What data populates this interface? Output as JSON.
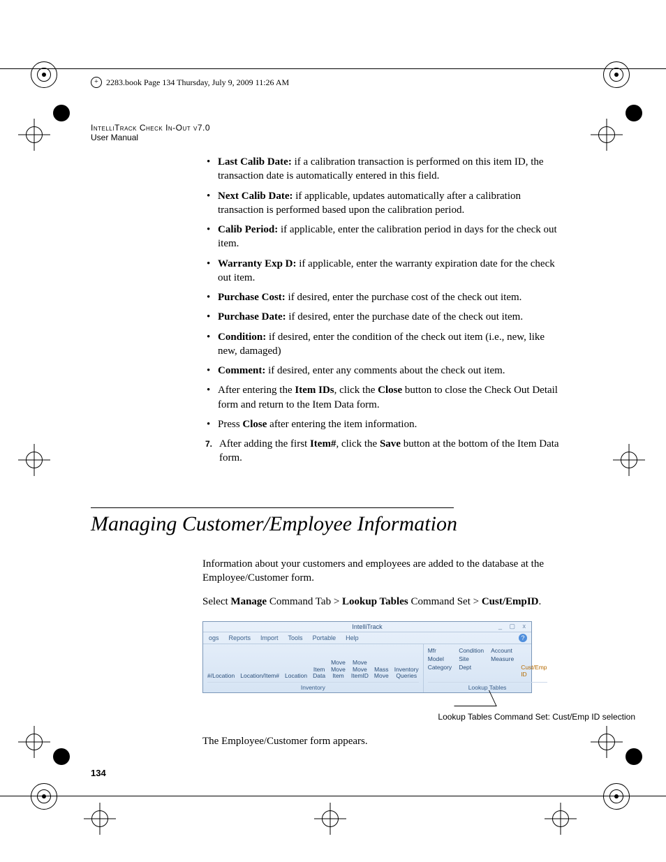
{
  "page_header": "2283.book  Page 134  Thursday, July 9, 2009  11:26 AM",
  "running_head": {
    "line1": "IntelliTrack Check In-Out v7.0",
    "line2": "User Manual"
  },
  "bullets": [
    {
      "term": "Last Calib Date:",
      "text": " if a calibration transaction is performed on this item ID, the transaction date is automatically entered in this field."
    },
    {
      "term": "Next Calib Date:",
      "text": " if applicable, updates automatically after a calibration transaction is performed based upon the calibration period."
    },
    {
      "term": "Calib Period:",
      "text": " if applicable, enter the calibration period in days for the check out item."
    },
    {
      "term": "Warranty Exp D:",
      "text": " if applicable, enter the warranty expiration date for the check out item."
    },
    {
      "term": "Purchase Cost:",
      "text": " if desired, enter the purchase cost of the check out item."
    },
    {
      "term": "Purchase Date:",
      "text": " if desired, enter the purchase date of the check out item."
    },
    {
      "term": "Condition:",
      "text": " if desired, enter the condition of the check out item (i.e., new, like new, damaged)"
    },
    {
      "term": "Comment:",
      "text": " if desired, enter any comments about the check out item."
    }
  ],
  "bullets_plain": [
    {
      "pre": "After entering the ",
      "b1": "Item IDs",
      "mid": ", click the ",
      "b2": "Close",
      "post": " button to close the Check Out Detail form and return to the Item Data form."
    },
    {
      "pre": "Press ",
      "b1": "Close",
      "post": " after entering the item information."
    }
  ],
  "step7": {
    "num": "7.",
    "pre": "After adding the first ",
    "b1": "Item#",
    "mid": ", click the ",
    "b2": "Save",
    "post": " button at the bottom of the Item Data form."
  },
  "section_title": "Managing Customer/Employee Information",
  "section_p1": "Information about your customers and employees are added to the database at the Employee/Customer form.",
  "section_p2": {
    "pre": "Select ",
    "b1": "Manage",
    "mid1": " Command Tab > ",
    "b2": "Lookup Tables",
    "mid2": " Command Set > ",
    "b3": "Cust/EmpID",
    "post": "."
  },
  "ribbon": {
    "title": "IntelliTrack",
    "tabs": [
      "ogs",
      "Reports",
      "Import",
      "Tools",
      "Portable",
      "Help"
    ],
    "inventory_group": {
      "items": [
        "#/Location",
        "Location/Item#",
        "Location",
        "Item Data",
        "Move Move Item",
        "Move Move ItemID",
        "Mass Move",
        "Inventory Queries"
      ],
      "label": "Inventory"
    },
    "lookup_group": {
      "rows": [
        [
          "Mfr",
          "Condition",
          "Account",
          ""
        ],
        [
          "Model",
          "Site",
          "Measure",
          ""
        ],
        [
          "Category",
          "Dept",
          "",
          "Cust/Emp ID"
        ]
      ],
      "label": "Lookup Tables"
    }
  },
  "fig_caption": "Lookup Tables Command Set: Cust/Emp ID selection",
  "section_p3": "The Employee/Customer form appears.",
  "page_number": "134"
}
